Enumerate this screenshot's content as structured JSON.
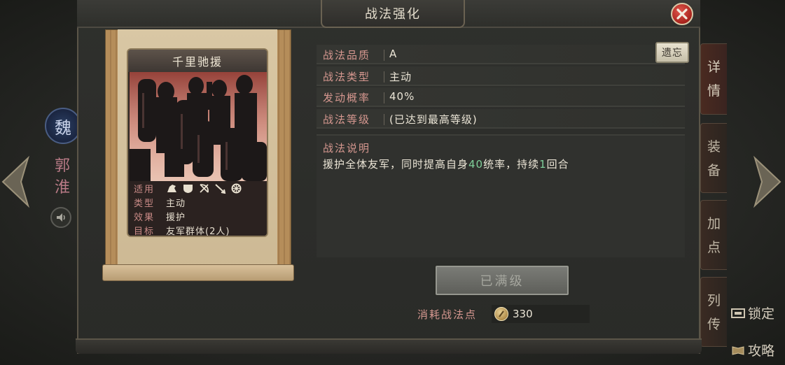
{
  "background": {
    "faction": "魏",
    "general_name": "郭淮",
    "side_tabs": [
      "详情",
      "装备",
      "加点",
      "列传"
    ],
    "lock_label": "锁定",
    "strategy_label": "攻略"
  },
  "dialog": {
    "title": "战法强化",
    "card": {
      "name": "千里驰援",
      "applicable_label": "适用",
      "troop_icons": [
        "cavalry-icon",
        "shield-icon",
        "bow-icon",
        "spear-icon",
        "wheel-icon"
      ],
      "type_label": "类型",
      "type_value": "主动",
      "effect_label": "效果",
      "effect_value": "援护",
      "target_label": "目标",
      "target_value": "友军群体(2人)"
    },
    "attributes": [
      {
        "label": "战法品质",
        "value": "A"
      },
      {
        "label": "战法类型",
        "value": "主动"
      },
      {
        "label": "发动概率",
        "value": "40%"
      },
      {
        "label": "战法等级",
        "value": "(已达到最高等级)"
      }
    ],
    "forget_button": "遗忘",
    "description": {
      "title": "战法说明",
      "part1": "援护全体友军，同时提高自身",
      "num1": "40",
      "part2": "统率，持续",
      "num2": "1",
      "part3": "回合"
    },
    "maxed_button": "已满级",
    "cost_label": "消耗战法点",
    "cost_value": "330"
  },
  "colors": {
    "label_pink": "#d69890",
    "highlight_green": "#7fd09a",
    "close_red": "#a8231d"
  }
}
